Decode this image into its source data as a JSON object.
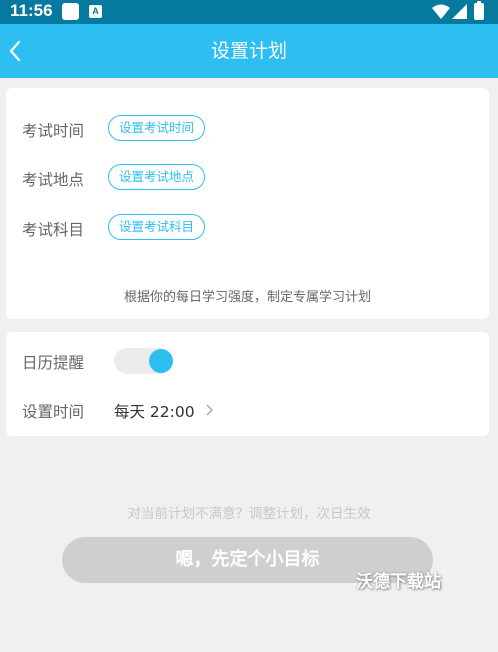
{
  "status_bar": {
    "time": "11:56",
    "badge_letter": "A"
  },
  "nav": {
    "title": "设置计划"
  },
  "plan_card": {
    "rows": [
      {
        "label": "考试时间",
        "button": "设置考试时间"
      },
      {
        "label": "考试地点",
        "button": "设置考试地点"
      },
      {
        "label": "考试科目",
        "button": "设置考试科目"
      }
    ],
    "hint": "根据你的每日学习强度，制定专属学习计划"
  },
  "calendar_card": {
    "reminder_label": "日历提醒",
    "reminder_enabled": true,
    "time_label": "设置时间",
    "time_value": "每天 22:00"
  },
  "footer": {
    "hint": "对当前计划不满意？调整计划，次日生效",
    "button": "嗯，先定个小目标"
  },
  "watermark": "沃德下载站",
  "colors": {
    "primary": "#2ebff2",
    "status_bar": "#067a9e",
    "background": "#f0f0f0",
    "button_disabled": "#cfcfcf"
  },
  "icons": [
    "back-icon",
    "wifi-icon",
    "signal-icon",
    "battery-icon",
    "chevron-right-icon"
  ]
}
